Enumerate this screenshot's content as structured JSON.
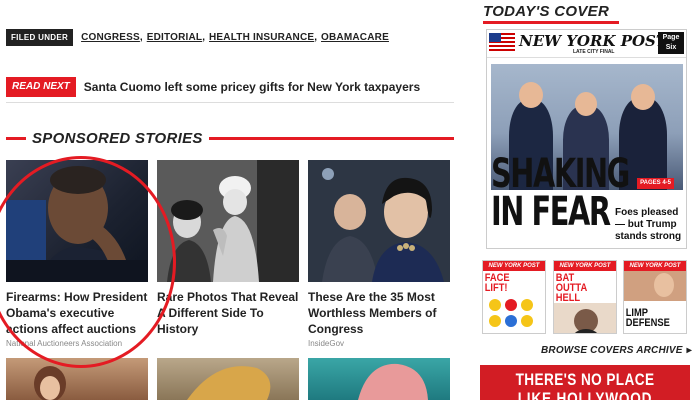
{
  "filed_under": {
    "label": "FILED UNDER",
    "tags": [
      "CONGRESS",
      "EDITORIAL",
      "HEALTH INSURANCE",
      "OBAMACARE"
    ]
  },
  "read_next": {
    "label": "READ NEXT",
    "headline": "Santa Cuomo left some pricey gifts for New York taxpayers"
  },
  "sponsored": {
    "title": "SPONSORED STORIES",
    "cards": [
      {
        "title": "Firearms: How President Obama's executive actions affect auctions",
        "source": "National Auctioneers Association"
      },
      {
        "title": "Rare Photos That Reveal A Different Side To History",
        "source": ""
      },
      {
        "title": "These Are the 35 Most Worthless Members of Congress",
        "source": "InsideGov"
      }
    ]
  },
  "todays_cover": {
    "title": "TODAY'S COVER",
    "masthead": "NEW YORK POST",
    "edition": "LATE CITY FINAL",
    "page_six": "Page Six",
    "headline_line1": "SHAKING",
    "headline_line2": "IN FEAR",
    "pages_badge": "PAGES 4-5",
    "subhead": "Foes pleased — but Trump stands strong"
  },
  "mini_covers": [
    {
      "masthead": "NEW YORK POST",
      "title": "FACE LIFT!"
    },
    {
      "masthead": "NEW YORK POST",
      "title": "BAT OUTTA HELL"
    },
    {
      "masthead": "NEW YORK POST",
      "title": "LIMP DEFENSE"
    }
  ],
  "browse": {
    "label": "BROWSE COVERS ARCHIVE"
  },
  "ad": {
    "line1": "THERE'S NO PLACE",
    "line2": "LIKE HOLLYWOOD"
  },
  "colors": {
    "accent": "#e41b23",
    "dark": "#222222"
  }
}
